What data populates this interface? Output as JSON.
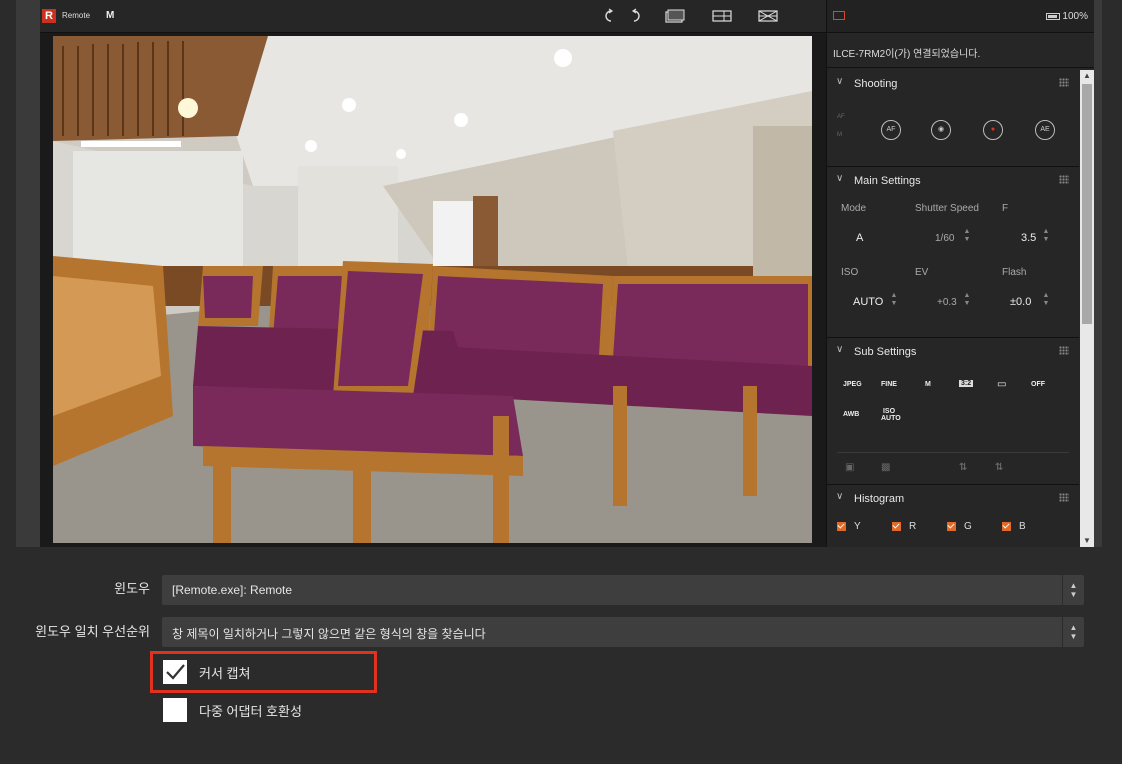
{
  "app": {
    "logo": "R",
    "name": "Remote",
    "mode_badge": "M",
    "toolbar_icons": [
      "rotate-left-icon",
      "rotate-right-icon",
      "live-view-icon",
      "layout-icon",
      "grid-icon"
    ]
  },
  "panel": {
    "battery": "100%",
    "message": "ILCE-7RM2이(가) 연결되었습니다.",
    "shooting": {
      "title": "Shooting",
      "side_labels": [
        "AF",
        "M"
      ],
      "buttons": [
        "AF",
        "shutter",
        "REC",
        "AE"
      ]
    },
    "main_settings": {
      "title": "Main Settings",
      "mode_label": "Mode",
      "mode_value": "A",
      "shutter_label": "Shutter Speed",
      "shutter_value": "1/60",
      "f_label": "F",
      "f_value": "3.5",
      "iso_label": "ISO",
      "iso_value": "AUTO",
      "ev_label": "EV",
      "ev_value": "+0.3",
      "flash_label": "Flash",
      "flash_value": "±0.0"
    },
    "sub_settings": {
      "title": "Sub Settings",
      "items": [
        "JPEG",
        "FINE",
        "M",
        "3:2",
        "▭",
        "OFF"
      ],
      "items2": [
        "AWB",
        "ISO AUTO"
      ]
    },
    "histogram": {
      "title": "Histogram",
      "channels": [
        "Y",
        "R",
        "G",
        "B"
      ]
    }
  },
  "form": {
    "window_label": "윈도우",
    "window_value": "[Remote.exe]: Remote",
    "priority_label": "윈도우 일치 우선순위",
    "priority_value": "창 제목이 일치하거나 그렇지 않으면 같은 형식의 창을 찾습니다",
    "capture_cursor_label": "커서 캡쳐",
    "capture_cursor_checked": true,
    "multi_adapter_label": "다중 어댑터 호환성",
    "multi_adapter_checked": false
  },
  "colors": {
    "accent": "#e0321e",
    "background": "#2b2b2b",
    "chair_fabric": "#7a2a5a",
    "chair_wood": "#b5752e"
  }
}
